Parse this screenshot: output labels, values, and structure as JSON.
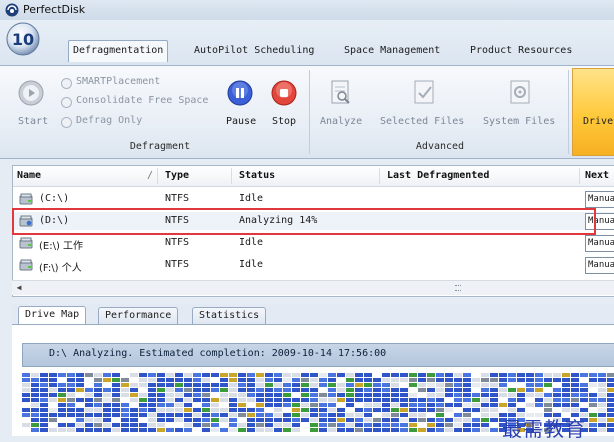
{
  "window": {
    "title": "PerfectDisk"
  },
  "orb": {
    "label": "10"
  },
  "tabs": [
    {
      "label": "Defragmentation",
      "active": true
    },
    {
      "label": "AutoPilot Scheduling",
      "active": false
    },
    {
      "label": "Space Management",
      "active": false
    },
    {
      "label": "Product Resources",
      "active": false
    }
  ],
  "ribbon": {
    "defragment": {
      "group_label": "Defragment",
      "start_label": "Start",
      "options": [
        "SMARTPlacement",
        "Consolidate Free Space",
        "Defrag Only"
      ],
      "pause_label": "Pause",
      "stop_label": "Stop"
    },
    "advanced": {
      "group_label": "Advanced",
      "analyze_label": "Analyze",
      "selected_files_label": "Selected Files",
      "system_files_label": "System Files"
    },
    "drive_label": "Drive"
  },
  "drive_list": {
    "columns": [
      "Name",
      "Type",
      "Status",
      "Last Defragmented",
      "Next"
    ],
    "rows": [
      {
        "name": "(C:\\)",
        "type": "NTFS",
        "status": "Idle",
        "last": "",
        "next": "Manual"
      },
      {
        "name": "(D:\\)",
        "type": "NTFS",
        "status": "Analyzing 14%",
        "last": "",
        "next": "Manual",
        "selected": true
      },
      {
        "name": "(E:\\) 工作",
        "type": "NTFS",
        "status": "Idle",
        "last": "",
        "next": "Manual"
      },
      {
        "name": "(F:\\) 个人",
        "type": "NTFS",
        "status": "Idle",
        "last": "",
        "next": "Manual"
      }
    ]
  },
  "bottom_tabs": [
    {
      "label": "Drive Map",
      "active": true
    },
    {
      "label": "Performance",
      "active": false
    },
    {
      "label": "Statistics",
      "active": false
    }
  ],
  "progress": {
    "text": "D:\\  Analyzing. Estimated completion: 2009-10-14 17:56:00"
  },
  "watermark": "最需教育",
  "colors": {
    "selected_border": "#e0383c",
    "pause_blue": "#3a5fd6",
    "stop_red": "#e2453c",
    "drive_gold": "#ffc93b"
  }
}
